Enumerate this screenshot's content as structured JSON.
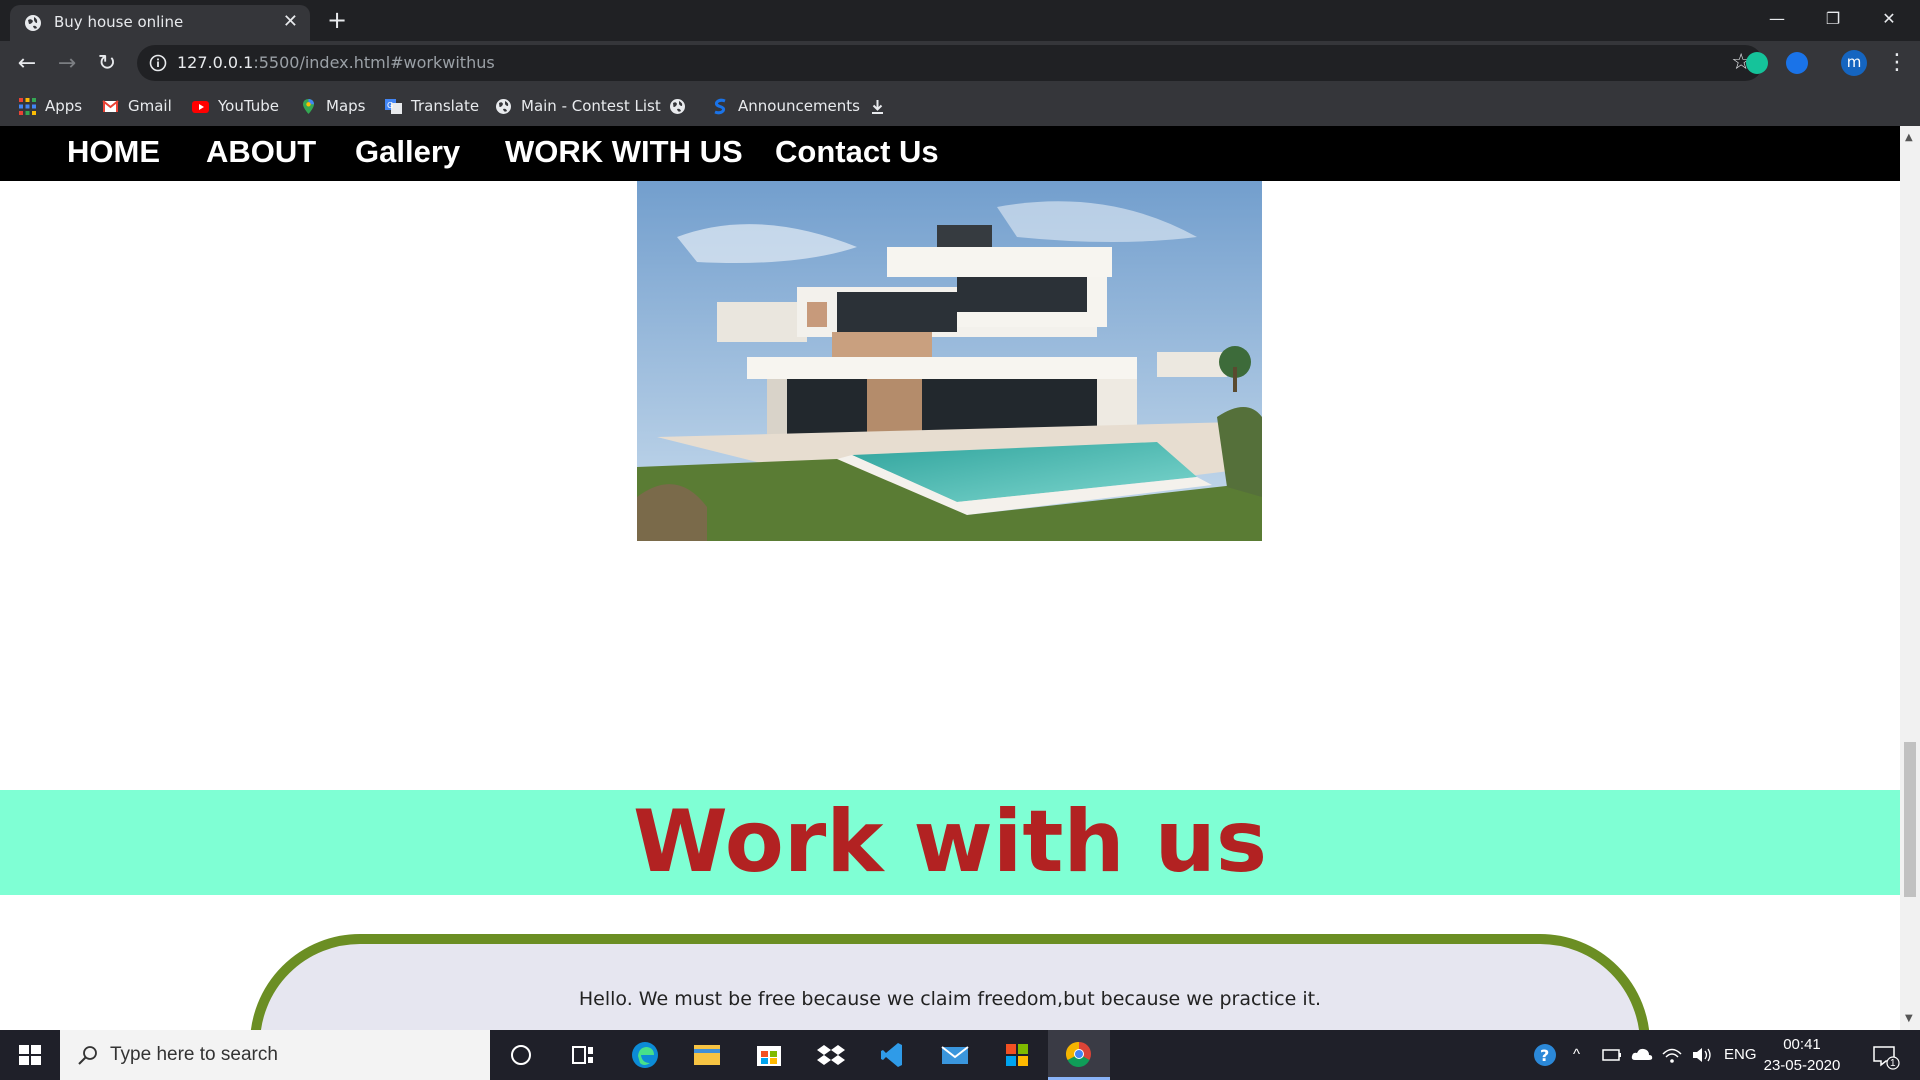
{
  "browser": {
    "tab_title": "Buy house online",
    "url_host": "127.0.0.1",
    "url_rest": ":5500/index.html#workwithus",
    "profile_initial": "m",
    "bookmarks": [
      {
        "label": "Apps",
        "icon": "apps-grid-icon"
      },
      {
        "label": "Gmail",
        "icon": "gmail-icon"
      },
      {
        "label": "YouTube",
        "icon": "youtube-icon"
      },
      {
        "label": "Maps",
        "icon": "maps-pin-icon"
      },
      {
        "label": "Translate",
        "icon": "translate-icon"
      },
      {
        "label": "Main - Contest List",
        "icon": "globe-icon"
      },
      {
        "label": "Announcements",
        "icon": "s-logo-icon"
      }
    ]
  },
  "site": {
    "nav": [
      "HOME",
      "ABOUT",
      "Gallery",
      "WORK WITH US",
      "Contact Us"
    ],
    "section_title": "Work with us",
    "quote": "Hello. We must be free because we claim freedom,but because we practice it."
  },
  "taskbar": {
    "search_placeholder": "Type here to search",
    "language": "ENG",
    "time": "00:41",
    "date": "23-05-2020",
    "notification_count": "1"
  }
}
